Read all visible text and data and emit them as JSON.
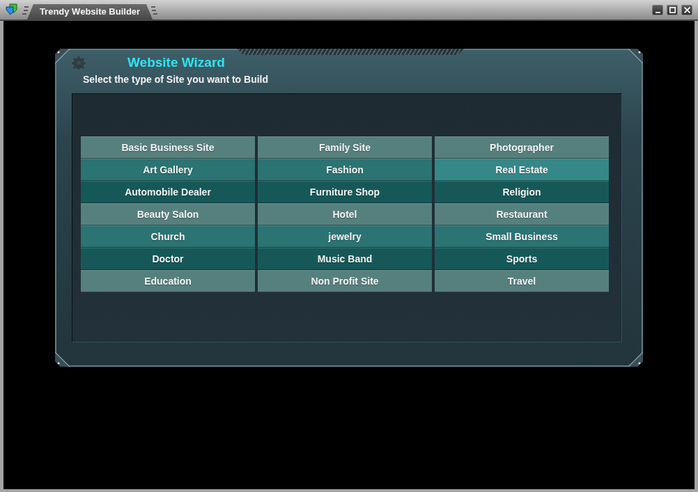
{
  "window": {
    "title": "Trendy Website Builder"
  },
  "wizard": {
    "title": "Website Wizard",
    "subtitle": "Select the type of Site you want to Build",
    "rows": [
      {
        "options": [
          {
            "label": "Basic Business Site",
            "selected": false
          },
          {
            "label": "Family Site",
            "selected": false
          },
          {
            "label": "Photographer",
            "selected": false
          }
        ]
      },
      {
        "options": [
          {
            "label": "Art Gallery",
            "selected": false
          },
          {
            "label": "Fashion",
            "selected": false
          },
          {
            "label": "Real Estate",
            "selected": true
          }
        ]
      },
      {
        "options": [
          {
            "label": "Automobile Dealer",
            "selected": false
          },
          {
            "label": "Furniture Shop",
            "selected": false
          },
          {
            "label": "Religion",
            "selected": false
          }
        ]
      },
      {
        "options": [
          {
            "label": "Beauty Salon",
            "selected": false
          },
          {
            "label": "Hotel",
            "selected": false
          },
          {
            "label": "Restaurant",
            "selected": false
          }
        ]
      },
      {
        "options": [
          {
            "label": "Church",
            "selected": false
          },
          {
            "label": "jewelry",
            "selected": false
          },
          {
            "label": "Small Business",
            "selected": false
          }
        ]
      },
      {
        "options": [
          {
            "label": "Doctor",
            "selected": false
          },
          {
            "label": "Music Band",
            "selected": false
          },
          {
            "label": "Sports",
            "selected": false
          }
        ]
      },
      {
        "options": [
          {
            "label": "Education",
            "selected": false
          },
          {
            "label": "Non Profit Site",
            "selected": false
          },
          {
            "label": "Travel",
            "selected": false
          }
        ]
      }
    ]
  }
}
